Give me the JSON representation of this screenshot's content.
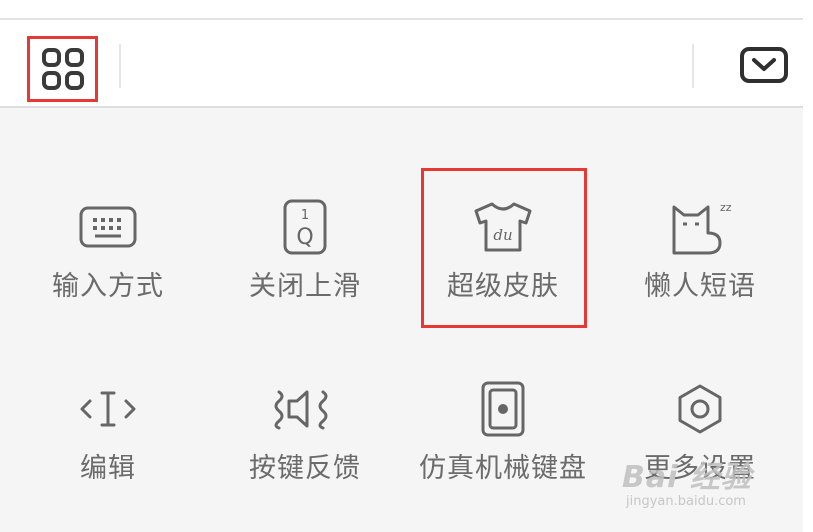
{
  "toolbar": {
    "menu_icon": "grid-four-squares-icon",
    "collapse_icon": "chevron-down-box-icon"
  },
  "panel": {
    "row1": [
      {
        "label": "输入方式",
        "icon": "keyboard-icon"
      },
      {
        "label": "关闭上滑",
        "icon": "slide-up-key-icon"
      },
      {
        "label": "超级皮肤",
        "icon": "tshirt-skin-icon",
        "icon_text": "du"
      },
      {
        "label": "懒人短语",
        "icon": "sleeping-cat-icon",
        "icon_text": "zz"
      }
    ],
    "row2": [
      {
        "label": "编辑",
        "icon": "cursor-edit-icon"
      },
      {
        "label": "按键反馈",
        "icon": "vibrate-sound-icon"
      },
      {
        "label": "仿真机械键盘",
        "icon": "mechanical-keyboard-icon"
      },
      {
        "label": "更多设置",
        "icon": "gear-icon"
      }
    ]
  },
  "watermark": {
    "brand": "Bai 经验",
    "url": "jingyan.baidu.com"
  },
  "colors": {
    "highlight": "#e53935",
    "icon_stroke": "#666666",
    "label_text": "#6b6b6b",
    "panel_bg": "#f5f5f6"
  }
}
